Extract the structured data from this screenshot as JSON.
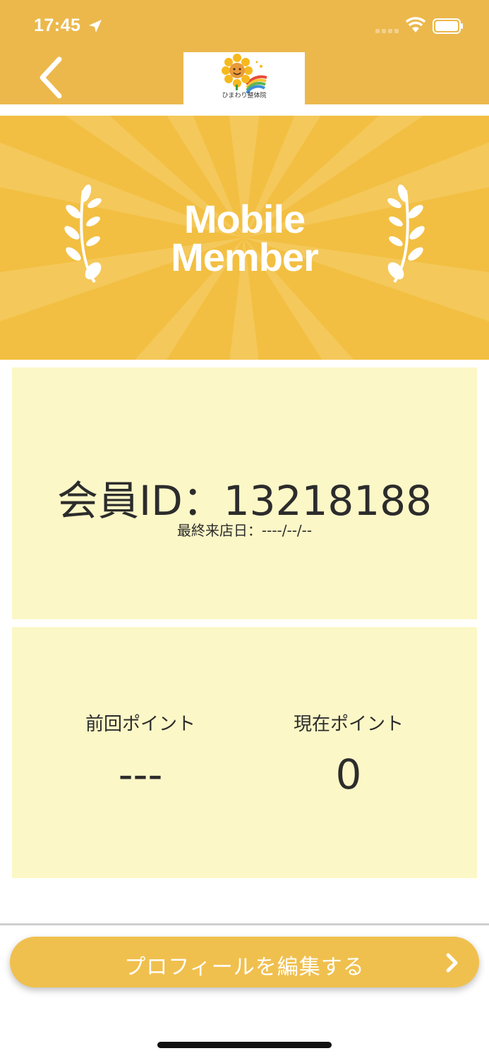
{
  "status_bar": {
    "time": "17:45"
  },
  "header": {
    "logo_name": "ひまわり整体院",
    "logo_icon": "sunflower-rainbow-logo"
  },
  "banner": {
    "title_line1": "Mobile",
    "title_line2": "Member"
  },
  "member_card": {
    "member_id": "会員ID：13218188",
    "last_visit": "最終来店日：----/--/--"
  },
  "points": {
    "previous_label": "前回ポイント",
    "previous_value": "---",
    "current_label": "現在ポイント",
    "current_value": "0"
  },
  "edit_button": {
    "label": "プロフィールを編集する"
  },
  "colors": {
    "header": "#ecb84c",
    "banner": "#f2bf42",
    "card": "#fcf7c7",
    "button": "#f0c04e"
  }
}
